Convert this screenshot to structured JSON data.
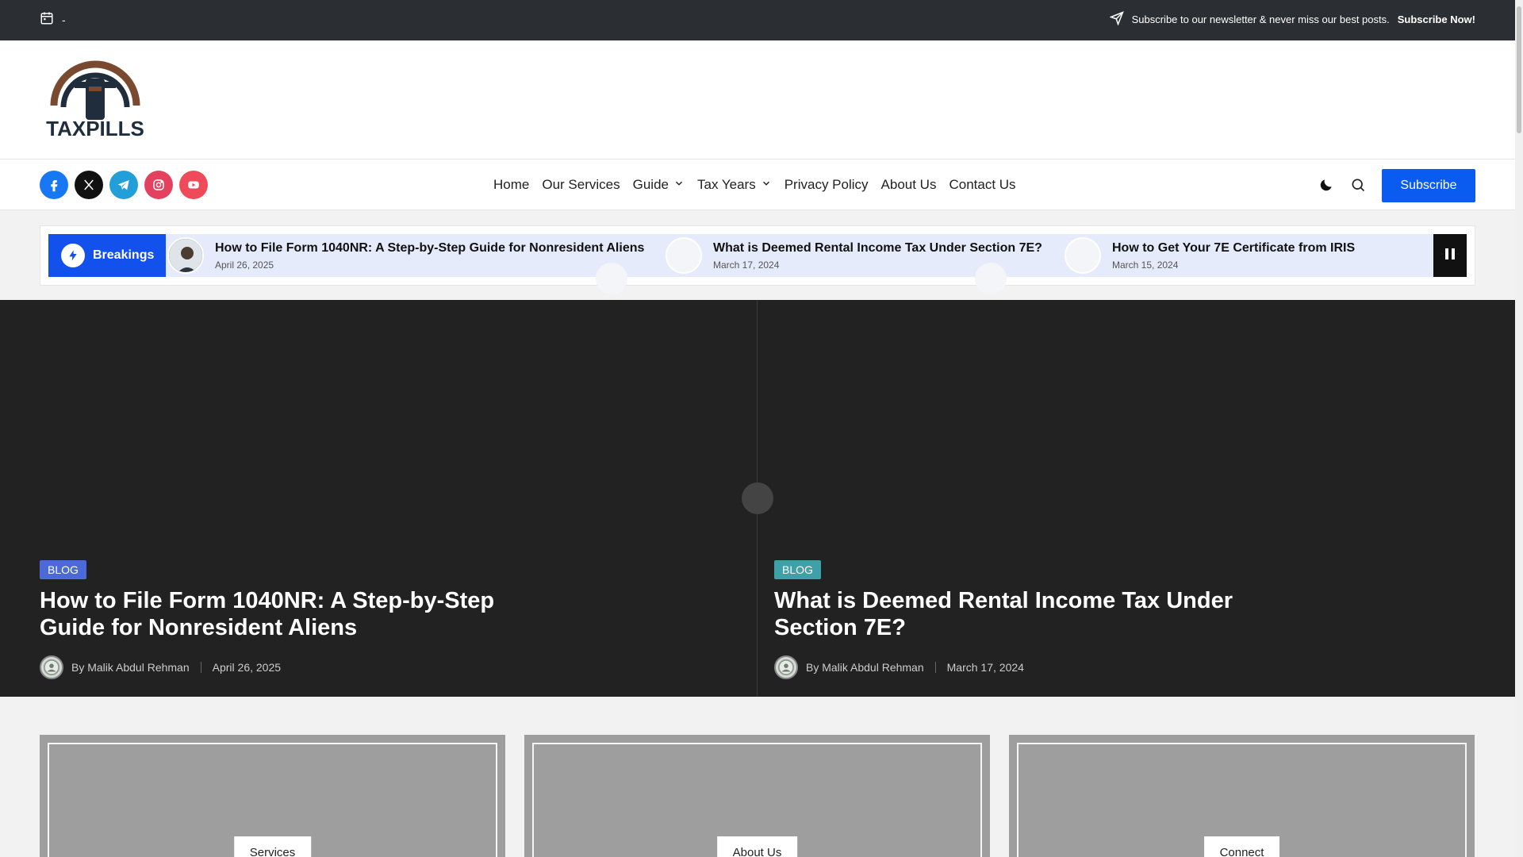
{
  "topbar": {
    "date": "-",
    "newsletter_text": "Subscribe to our newsletter & never miss our best posts.",
    "newsletter_cta": "Subscribe Now!"
  },
  "logo": {
    "text": "TAXPILLS"
  },
  "socials": [
    {
      "name": "facebook",
      "color": "#1877f2"
    },
    {
      "name": "x-twitter",
      "color": "#111111"
    },
    {
      "name": "telegram",
      "color": "#229ed9"
    },
    {
      "name": "instagram",
      "color": "#e4405f"
    },
    {
      "name": "youtube",
      "color": "#ef4a5a"
    }
  ],
  "menu": {
    "home": "Home",
    "services": "Our Services",
    "guide": "Guide",
    "tax_years": "Tax Years",
    "privacy": "Privacy Policy",
    "about": "About Us",
    "contact": "Contact Us"
  },
  "subscribe_button": "Subscribe",
  "ticker": {
    "label": "Breakings",
    "items": [
      {
        "title": "How to File Form 1040NR: A Step-by-Step Guide for Nonresident Aliens",
        "date": "April 26, 2025"
      },
      {
        "title": "What is Deemed Rental Income Tax Under Section 7E?",
        "date": "March 17, 2024"
      },
      {
        "title": "How to Get Your 7E Certificate from IRIS",
        "date": "March 15, 2024"
      }
    ]
  },
  "hero_posts": [
    {
      "category": "BLOG",
      "category_color": "#4b6ad8",
      "title": "How to File Form 1040NR: A Step-by-Step Guide for Nonresident Aliens",
      "author": "By Malik Abdul Rehman",
      "date": "April 26, 2025"
    },
    {
      "category": "BLOG",
      "category_color": "#3fa0a8",
      "title": "What is Deemed Rental Income Tax Under Section 7E?",
      "author": "By Malik Abdul Rehman",
      "date": "March 17, 2024"
    }
  ],
  "cards": [
    {
      "label": "Services"
    },
    {
      "label": "About Us"
    },
    {
      "label": "Connect"
    }
  ],
  "colors": {
    "accent": "#0a5cf0",
    "breaking": "#1351ed",
    "topbar": "#2b2f33",
    "hero_bg": "#222222"
  }
}
